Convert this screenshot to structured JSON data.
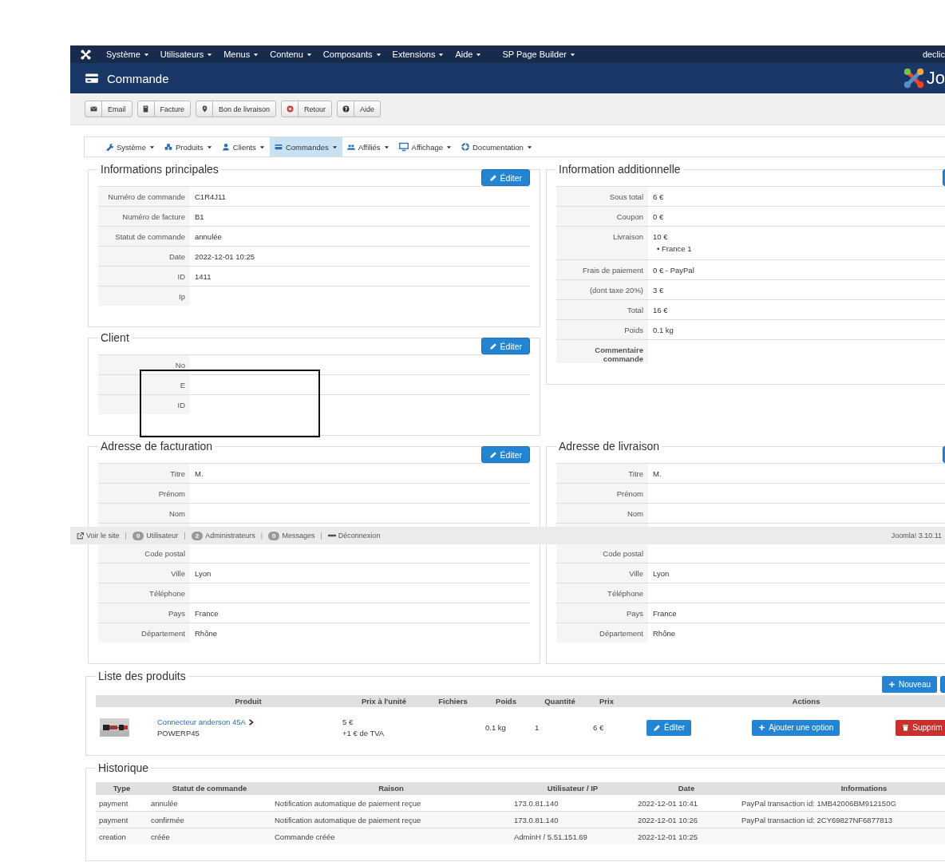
{
  "top_menu": {
    "items": [
      "Système",
      "Utilisateurs",
      "Menus",
      "Contenu",
      "Composants",
      "Extensions",
      "Aide",
      "SP Page Builder"
    ],
    "user": "declic"
  },
  "header": {
    "title": "Commande",
    "brand": "Jo"
  },
  "toolbar": [
    {
      "label": "Email",
      "kind": "envelope"
    },
    {
      "label": "Facture",
      "kind": "book"
    },
    {
      "label": "Bon de livraison",
      "kind": "pin"
    },
    {
      "label": "Retour",
      "kind": "xcircle"
    },
    {
      "label": "Aide",
      "kind": "question"
    }
  ],
  "submenu": [
    {
      "label": "Système",
      "kind": "wrench",
      "selected": false
    },
    {
      "label": "Produits",
      "kind": "cubes",
      "selected": false
    },
    {
      "label": "Clients",
      "kind": "user",
      "selected": false
    },
    {
      "label": "Commandes",
      "kind": "card",
      "selected": true
    },
    {
      "label": "Affiliés",
      "kind": "users",
      "selected": false
    },
    {
      "label": "Affichage",
      "kind": "monitor",
      "selected": false
    },
    {
      "label": "Documentation",
      "kind": "lifering",
      "selected": false
    }
  ],
  "left_panels": [
    {
      "title": "Informations principales",
      "edit_button": {
        "kind": "full",
        "label": "Éditer"
      },
      "rows": [
        {
          "label": "Numéro de commande",
          "value": "C1R4J11"
        },
        {
          "label": "Numéro de facture",
          "value": "B1"
        },
        {
          "label": "Statut de commande",
          "value": "annulée"
        },
        {
          "label": "Date",
          "value": "2022-12-01 10:25"
        },
        {
          "label": "ID",
          "value": "1411"
        },
        {
          "label": "Ip"
        }
      ]
    },
    {
      "title": "Client",
      "edit_button": {
        "kind": "full",
        "label": "Éditer"
      },
      "redaction_frame": true,
      "rows": [
        {
          "label": "No"
        },
        {
          "label": "E"
        },
        {
          "label": "ID"
        }
      ]
    }
  ],
  "right_panels": [
    {
      "title": "Information additionnelle",
      "edit_button": {
        "kind": "clipped"
      },
      "rows": [
        {
          "label": "Sous total",
          "value": "6 €"
        },
        {
          "label": "Coupon",
          "value": "0 €"
        },
        {
          "label": "Livraison",
          "value": "10 €",
          "subitems": [
            "• France 1"
          ]
        },
        {
          "label": "Frais de paiement",
          "value": "0 € - PayPal"
        },
        {
          "label": "(dont taxe 20%)",
          "value": "3 €"
        },
        {
          "label": "Total",
          "value": "16 €"
        },
        {
          "label": "Poids",
          "value": "0.1 kg"
        },
        {
          "label": "Commentaire commande",
          "kind": "strong"
        }
      ]
    }
  ],
  "address_panels": [
    {
      "title": "Adresse de facturation",
      "edit_button": {
        "kind": "full",
        "label": "Éditer"
      },
      "rows": [
        {
          "label": "Titre",
          "value": "M."
        },
        {
          "label": "Prénom"
        },
        {
          "label": "Nom"
        },
        {
          "kind": "blank"
        },
        {
          "label": "Code postal"
        },
        {
          "label": "Ville",
          "value": "Lyon"
        },
        {
          "label": "Téléphone"
        },
        {
          "label": "Pays",
          "value": "France"
        },
        {
          "label": "Département",
          "value": "Rhône"
        }
      ]
    },
    {
      "title": "Adresse de livraison",
      "edit_button": {
        "kind": "clipped"
      },
      "rows": [
        {
          "label": "Titre",
          "value": "M."
        },
        {
          "label": "Prénom"
        },
        {
          "label": "Nom"
        },
        {
          "kind": "blank"
        },
        {
          "label": "Code postal"
        },
        {
          "label": "Ville",
          "value": "Lyon"
        },
        {
          "label": "Téléphone"
        },
        {
          "label": "Pays",
          "value": "France"
        },
        {
          "label": "Département",
          "value": "Rhône"
        }
      ]
    }
  ],
  "status_bar": {
    "separator": "|",
    "items": [
      {
        "kind": "link",
        "label": "Voir le site"
      },
      {
        "kind": "badge",
        "count": "0",
        "label": "Utilisateur"
      },
      {
        "kind": "badge",
        "count": "2",
        "label": "Administrateurs"
      },
      {
        "kind": "badge",
        "count": "0",
        "label": "Messages"
      },
      {
        "kind": "logout",
        "label": "Déconnexion"
      }
    ],
    "version": "Joomla! 3.10.11"
  },
  "products": {
    "title": "Liste des produits",
    "new_button": "Nouveau",
    "columns": [
      "Produit",
      "Prix à l'unité",
      "Fichiers",
      "Poids",
      "Quantité",
      "Prix",
      "Actions"
    ],
    "rows": [
      {
        "name": "Connecteur anderson 45A",
        "sku": "POWERP45",
        "unit_price": "5 €",
        "tax": "+1 € de TVA",
        "weight": "0.1 kg",
        "quantity": "1",
        "price": "6 €",
        "actions": [
          {
            "kind": "edit",
            "label": "Éditer"
          },
          {
            "kind": "add",
            "label": "Ajouter une option"
          },
          {
            "kind": "delete",
            "label": "Supprim"
          }
        ]
      }
    ]
  },
  "history": {
    "title": "Historique",
    "columns": [
      "Type",
      "Statut de commande",
      "Raison",
      "Utilisateur / IP",
      "Date",
      "Informations"
    ],
    "rows": [
      [
        "payment",
        "annulée",
        "Notification automatique de paiement reçue",
        "173.0.81.140",
        "2022-12-01 10:41",
        "PayPal transaction id: 1MB42006BM912150G"
      ],
      [
        "payment",
        "confirmée",
        "Notification automatique de paiement reçue",
        "173.0.81.140",
        "2022-12-01 10:26",
        "PayPal transaction id: 2CY69827NF6877813"
      ],
      [
        "creation",
        "créée",
        "Commande créée",
        "AdminH / 5.51.151.69",
        "2022-12-01 10:25"
      ]
    ]
  }
}
